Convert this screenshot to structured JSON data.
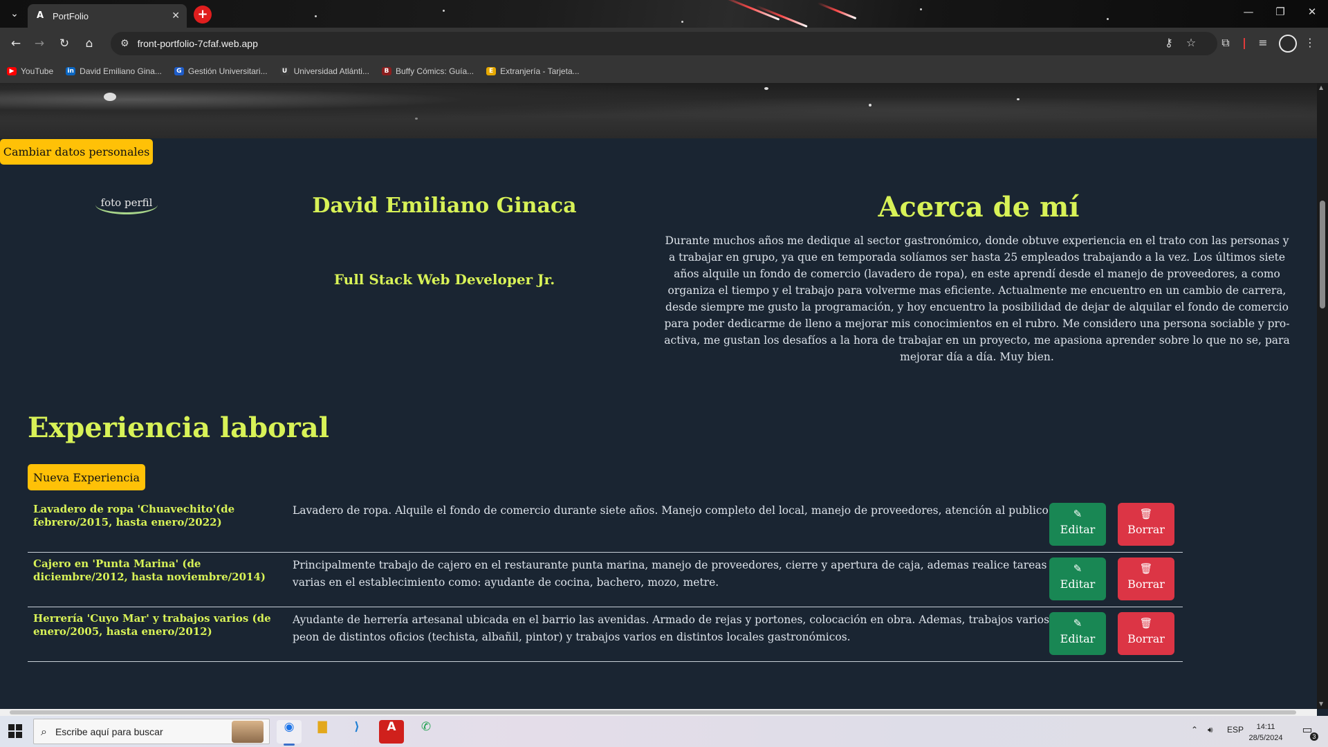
{
  "browser": {
    "tab_title": "PortFolio",
    "url": "front-portfolio-7cfaf.web.app",
    "bookmarks": [
      {
        "label": "YouTube",
        "icon": "youtube-icon",
        "color": "#ff0000"
      },
      {
        "label": "David Emiliano Gina...",
        "icon": "linkedin-icon",
        "color": "#0a66c2"
      },
      {
        "label": "Gestión Universitari...",
        "icon": "university-icon",
        "color": "#1e5cc8"
      },
      {
        "label": "Universidad Atlánti...",
        "icon": "university-icon",
        "color": "#3a3a3a"
      },
      {
        "label": "Buffy Cómics: Guía...",
        "icon": "buffy-icon",
        "color": "#8b1e1e"
      },
      {
        "label": "Extranjería - Tarjeta...",
        "icon": "extranjeria-icon",
        "color": "#e6a800"
      }
    ]
  },
  "page": {
    "personal_button": "Cambiar datos personales",
    "photo_alt": "foto perfil",
    "name": "David Emiliano Ginaca",
    "role": "Full Stack Web Developer Jr.",
    "about_title": "Acerca de mí",
    "about_text": "Durante muchos años me dedique al sector gastronómico, donde obtuve experiencia en el trato con las personas y a trabajar en grupo, ya que en temporada solíamos ser hasta 25 empleados trabajando a la vez. Los últimos siete años alquile un fondo de comercio (lavadero de ropa), en este aprendí desde el manejo de proveedores, a como organiza el tiempo y el trabajo para volverme mas eficiente. Actualmente me encuentro en un cambio de carrera, desde siempre me gusto la programación, y hoy encuentro la posibilidad de dejar de alquilar el fondo de comercio para poder dedicarme de lleno a mejorar mis conocimientos en el rubro. Me considero una persona sociable y pro-activa, me gustan los desafíos a la hora de trabajar en un proyecto, me apasiona aprender sobre lo que no se, para mejorar día a día. Muy bien.",
    "experience_title": "Experiencia laboral",
    "new_experience_button": "Nueva Experiencia",
    "experiences": [
      {
        "title": "Lavadero de ropa 'Chuavechito'(de febrero/2015, hasta enero/2022)",
        "description": "Lavadero de ropa. Alquile el fondo de comercio durante siete años. Manejo completo del local, manejo de proveedores, atención al publico."
      },
      {
        "title": "Cajero en 'Punta Marina' (de diciembre/2012, hasta noviembre/2014)",
        "description": "Principalmente trabajo de cajero en el restaurante punta marina, manejo de proveedores, cierre y apertura de caja, ademas realice tareas varias en el establecimiento como: ayudante de cocina, bachero, mozo, metre."
      },
      {
        "title": "Herrería 'Cuyo Mar' y trabajos varios (de enero/2005, hasta enero/2012)",
        "description": "Ayudante de herrería artesanal ubicada en el barrio las avenidas. Armado de rejas y portones, colocación en obra. Ademas, trabajos varios de peon de distintos oficios (techista, albañil, pintor) y trabajos varios en distintos locales gastronómicos."
      }
    ],
    "edit_label": "Editar",
    "delete_label": "Borrar",
    "colors": {
      "accent": "#d8f257",
      "background": "#1a2532",
      "warning": "#ffc107",
      "success": "#198754",
      "danger": "#dc3545"
    }
  },
  "taskbar": {
    "search_placeholder": "Escribe aquí para buscar",
    "language": "ESP",
    "time": "14:11",
    "date": "28/5/2024",
    "notifications": "3"
  }
}
